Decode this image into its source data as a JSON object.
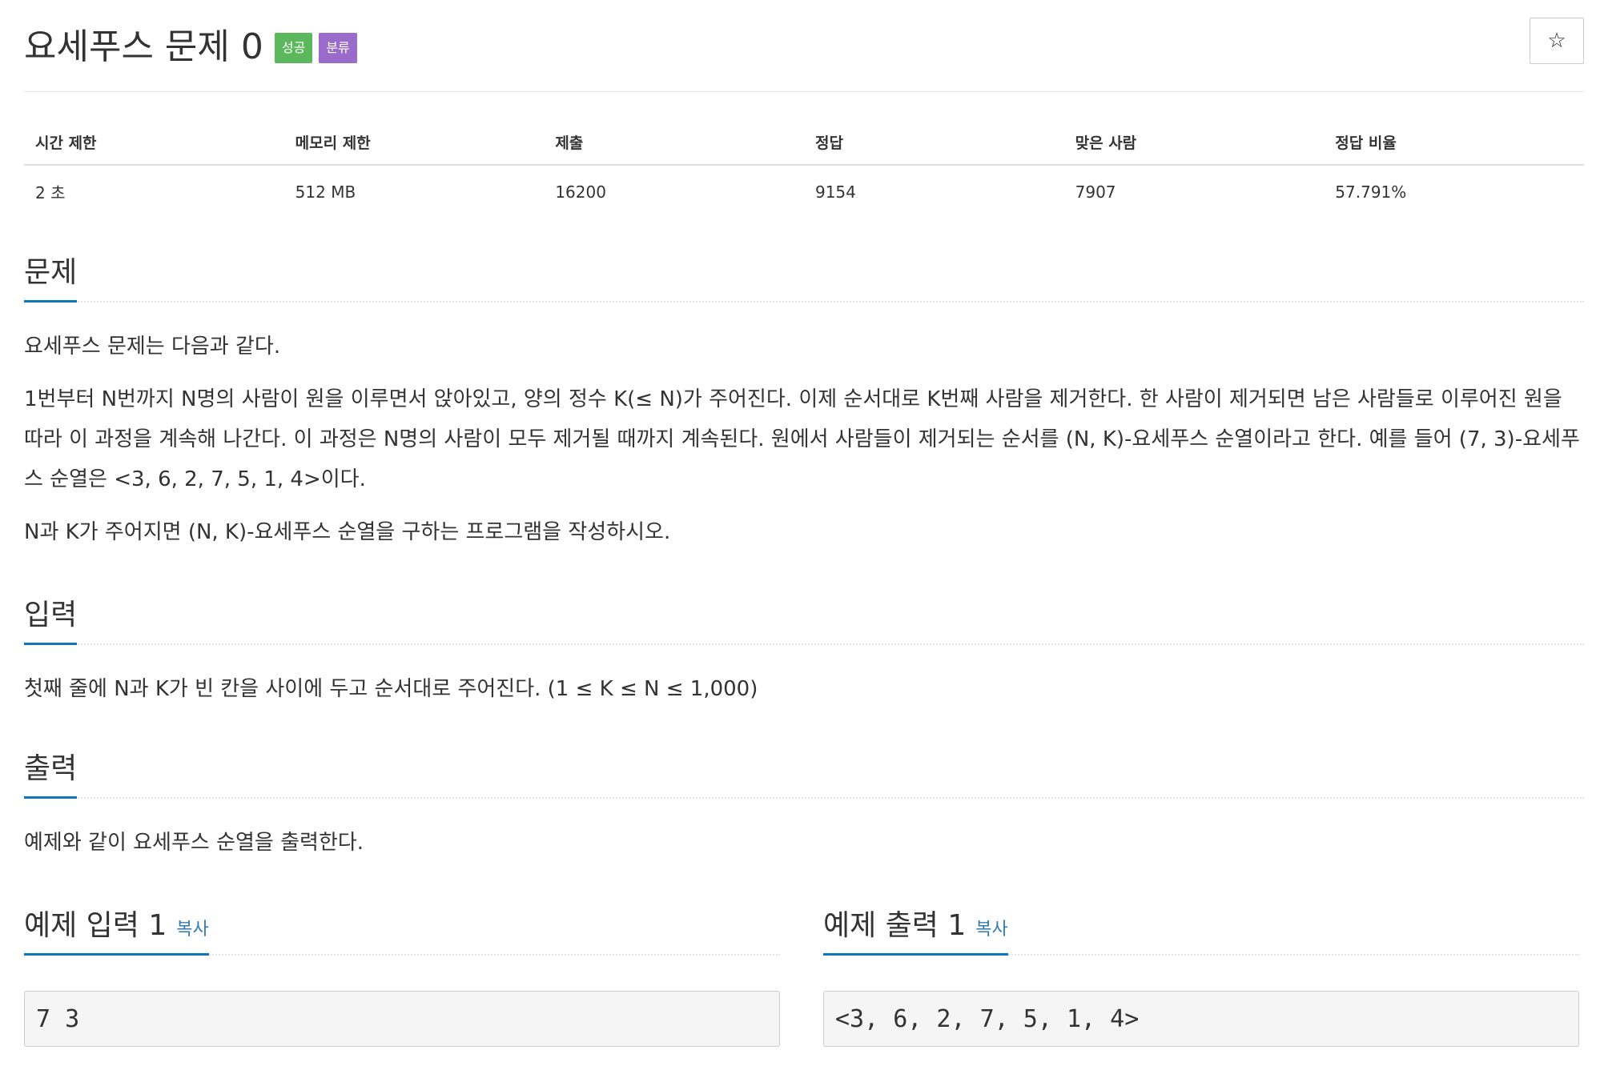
{
  "problem": {
    "title": "요세푸스 문제 0",
    "labels": {
      "success": "성공",
      "category": "분류"
    },
    "star": "☆"
  },
  "stats": {
    "headers": [
      "시간 제한",
      "메모리 제한",
      "제출",
      "정답",
      "맞은 사람",
      "정답 비율"
    ],
    "values": [
      "2 초",
      "512 MB",
      "16200",
      "9154",
      "7907",
      "57.791%"
    ]
  },
  "description": {
    "heading": "문제",
    "paragraphs": [
      "요세푸스 문제는 다음과 같다.",
      "1번부터 N번까지 N명의 사람이 원을 이루면서 앉아있고, 양의 정수 K(≤ N)가 주어진다. 이제 순서대로 K번째 사람을 제거한다. 한 사람이 제거되면 남은 사람들로 이루어진 원을 따라 이 과정을 계속해 나간다. 이 과정은 N명의 사람이 모두 제거될 때까지 계속된다. 원에서 사람들이 제거되는 순서를 (N, K)-요세푸스 순열이라고 한다. 예를 들어 (7, 3)-요세푸스 순열은 <3, 6, 2, 7, 5, 1, 4>이다.",
      "N과 K가 주어지면 (N, K)-요세푸스 순열을 구하는 프로그램을 작성하시오."
    ]
  },
  "input": {
    "heading": "입력",
    "text": "첫째 줄에 N과 K가 빈 칸을 사이에 두고 순서대로 주어진다. (1 ≤ K ≤ N ≤ 1,000)"
  },
  "output": {
    "heading": "출력",
    "text": "예제와 같이 요세푸스 순열을 출력한다."
  },
  "samples": {
    "input_heading": "예제 입력 1",
    "output_heading": "예제 출력 1",
    "copy_label": "복사",
    "input_value": "7 3",
    "output_value": "<3, 6, 2, 7, 5, 1, 4>"
  },
  "colors": {
    "success": "#5cb85c",
    "category": "#9b6bcc",
    "heading_underline": "#0e76c2",
    "link": "#337ab7"
  }
}
